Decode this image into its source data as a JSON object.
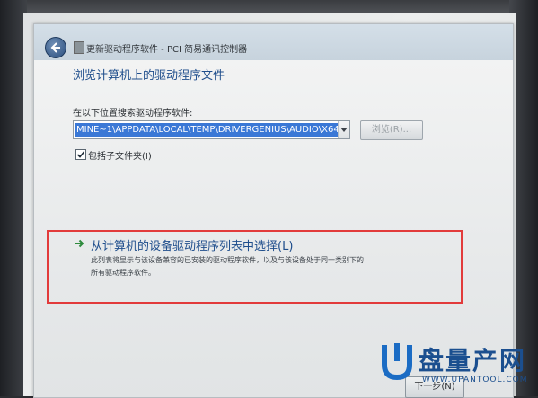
{
  "window": {
    "title": "更新驱动程序软件 - PCI 简易通讯控制器"
  },
  "page": {
    "heading": "浏览计算机上的驱动程序文件",
    "search_label": "在以下位置搜索驱动程序软件:",
    "path_value": "MINE~1\\APPDATA\\LOCAL\\TEMP\\DRIVERGENIUS\\AUDIO\\X64",
    "browse_label": "浏览(R)...",
    "include_subfolders_label": "包括子文件夹(I)",
    "include_subfolders_checked": true
  },
  "option": {
    "title": "从计算机的设备驱动程序列表中选择(L)",
    "desc_line1": "此列表将显示与该设备兼容的已安装的驱动程序软件，以及与该设备处于同一类别下的",
    "desc_line2": "所有驱动程序软件。"
  },
  "footer": {
    "next_label": "下一步(N)"
  },
  "watermark": {
    "main": "盘量产网",
    "sub": "WWW.UPANTOOL.COM"
  },
  "colors": {
    "highlight": "#e23b3b",
    "link_blue": "#1f4e8c",
    "selection": "#3a78d6"
  }
}
